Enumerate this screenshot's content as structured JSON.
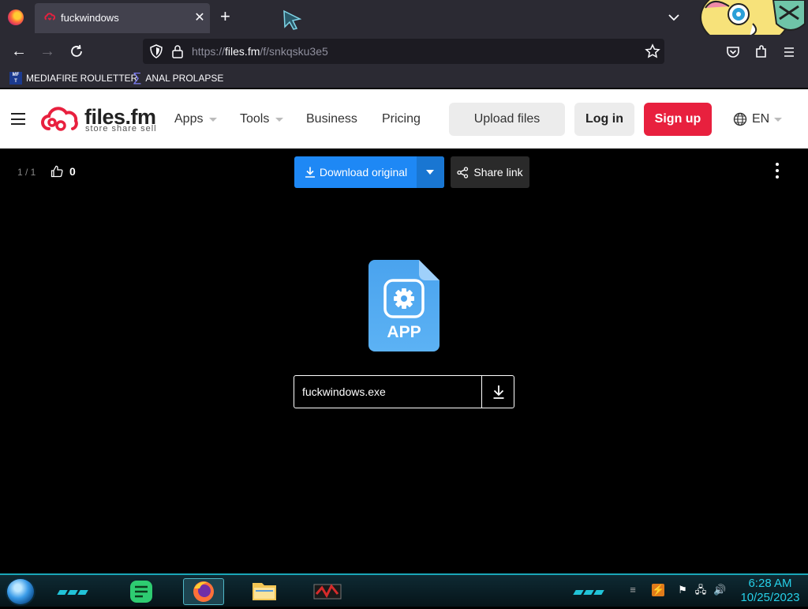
{
  "browser": {
    "tab": {
      "title": "fuckwindows"
    },
    "url": {
      "prefix": "https://",
      "host": "files.fm",
      "path": "/f/snkqsku3e5"
    },
    "bookmarks": [
      {
        "label": "MEDIAFIRE ROULETTER",
        "icon": "MF"
      },
      {
        "label": "ANAL PROLAPSE",
        "icon": "sigma"
      }
    ]
  },
  "site": {
    "logo": {
      "name": "files.fm",
      "tagline": "store  share  sell"
    },
    "nav": [
      "Apps",
      "Tools",
      "Business",
      "Pricing"
    ],
    "upload_label": "Upload files",
    "login_label": "Log in",
    "signup_label": "Sign up",
    "language": "EN"
  },
  "viewer": {
    "pager": "1 / 1",
    "likes": "0",
    "download_label": "Download original",
    "share_label": "Share link",
    "file_type_label": "APP",
    "file_name": "fuckwindows.exe"
  },
  "taskbar": {
    "time": "6:28 AM",
    "date": "10/25/2023"
  },
  "colors": {
    "brand_red": "#e8203e",
    "download_blue": "#1e88f5",
    "file_icon_blue": "#4aa3ee",
    "clock_cyan": "#26d0e8"
  }
}
